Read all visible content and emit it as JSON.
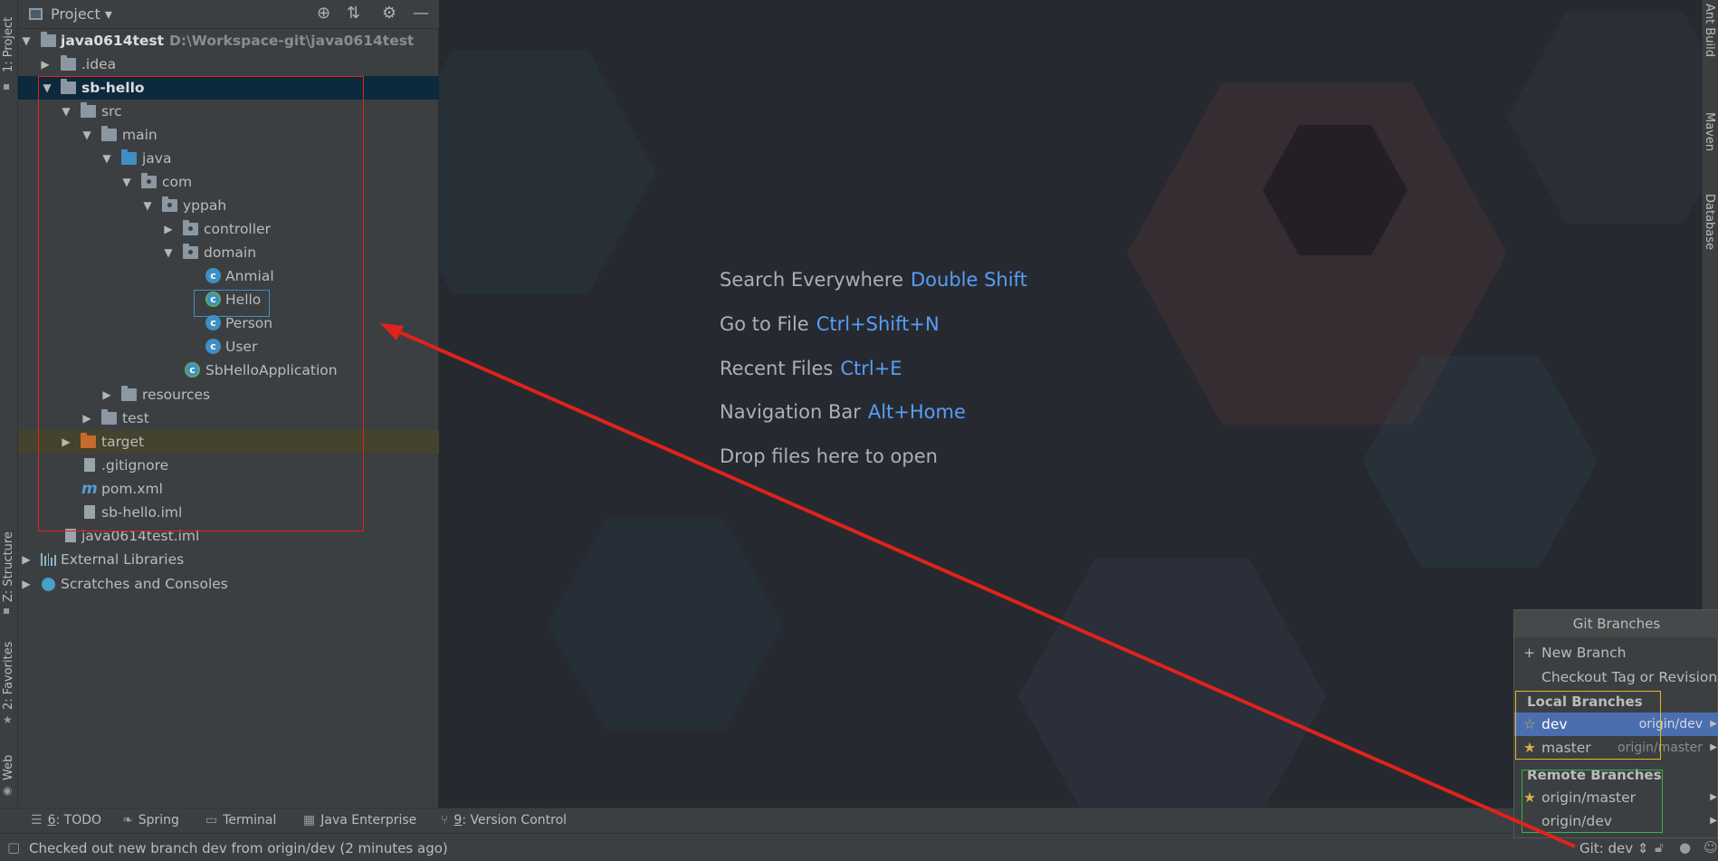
{
  "colors": {
    "selection": "#0d293e",
    "shortcut": "#589df6",
    "annotation_red": "#e0221c",
    "popup_selected": "#4b6eaf",
    "highlight_yellow": "#e6b422",
    "highlight_green": "#38b04a"
  },
  "left_stripe": {
    "tabs": [
      "1: Project",
      "Z: Structure",
      "2: Favorites",
      "Web"
    ]
  },
  "right_stripe": {
    "tabs": [
      "Ant Build",
      "Maven",
      "Database"
    ]
  },
  "project_panel": {
    "title": "Project",
    "icons": [
      "locate-icon",
      "collapse-all-icon",
      "gear-icon",
      "minimize-icon"
    ]
  },
  "tree": {
    "root": {
      "label": "java0614test",
      "path": "D:\\Workspace-git\\java0614test"
    },
    "idea": ".idea",
    "sb_hello": "sb-hello",
    "src": "src",
    "main": "main",
    "java": "java",
    "com": "com",
    "yppah": "yppah",
    "controller": "controller",
    "domain": "domain",
    "anmial": "Anmial",
    "hello": "Hello",
    "person": "Person",
    "user": "User",
    "app": "SbHelloApplication",
    "resources": "resources",
    "test": "test",
    "target": "target",
    "gitignore": ".gitignore",
    "pom": "pom.xml",
    "iml": "sb-hello.iml",
    "root_iml": "java0614test.iml",
    "ext_libs": "External Libraries",
    "scratches": "Scratches and Consoles"
  },
  "editor_hints": [
    {
      "label": "Search Everywhere",
      "shortcut": "Double Shift"
    },
    {
      "label": "Go to File",
      "shortcut": "Ctrl+Shift+N"
    },
    {
      "label": "Recent Files",
      "shortcut": "Ctrl+E"
    },
    {
      "label": "Navigation Bar",
      "shortcut": "Alt+Home"
    },
    {
      "label": "Drop files here to open",
      "shortcut": ""
    }
  ],
  "tool_bar": {
    "todo_num": "6",
    "todo": ": TODO",
    "spring": "Spring",
    "terminal": "Terminal",
    "java_ee": "Java Enterprise",
    "vc_num": "9",
    "vc": ": Version Control"
  },
  "status": {
    "message": "Checked out new branch dev from origin/dev (2 minutes ago)",
    "git": "Git: dev"
  },
  "git_popup": {
    "title": "Git Branches",
    "new_branch": "New Branch",
    "checkout": "Checkout Tag or Revision...",
    "local_header": "Local Branches",
    "local": [
      {
        "name": "dev",
        "tracking": "origin/dev"
      },
      {
        "name": "master",
        "tracking": "origin/master"
      }
    ],
    "remote_header": "Remote Branches",
    "remote": [
      "origin/master",
      "origin/dev"
    ]
  }
}
